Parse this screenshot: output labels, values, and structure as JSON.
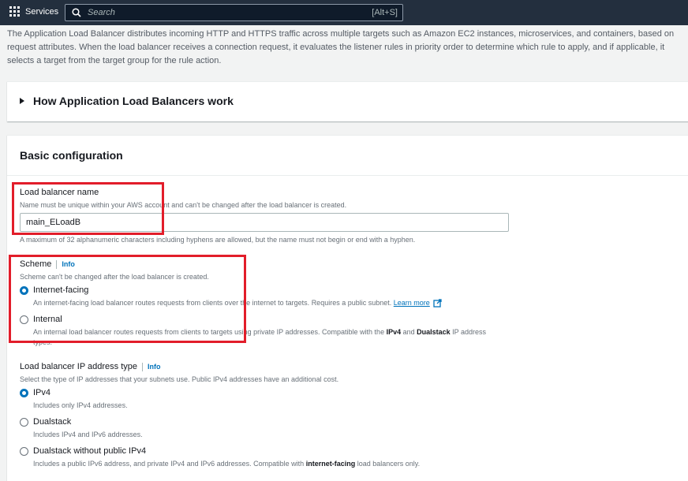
{
  "topbar": {
    "services_label": "Services",
    "search_placeholder": "Search",
    "search_shortcut": "[Alt+S]"
  },
  "intro_text": "The Application Load Balancer distributes incoming HTTP and HTTPS traffic across multiple targets such as Amazon EC2 instances, microservices, and containers, based on request attributes. When the load balancer receives a connection request, it evaluates the listener rules in priority order to determine which rule to apply, and if applicable, it selects a target from the target group for the rule action.",
  "how_section": {
    "title": "How Application Load Balancers work"
  },
  "basic_config": {
    "title": "Basic configuration",
    "name_field": {
      "label": "Load balancer name",
      "description": "Name must be unique within your AWS account and can't be changed after the load balancer is created.",
      "value": "main_ELoadB",
      "constraint": "A maximum of 32 alphanumeric characters including hyphens are allowed, but the name must not begin or end with a hyphen."
    },
    "scheme": {
      "label": "Scheme",
      "info": "Info",
      "description": "Scheme can't be changed after the load balancer is created.",
      "selected": "Internet-facing",
      "options": [
        {
          "label": "Internet-facing",
          "description": "An internet-facing load balancer routes requests from clients over the internet to targets. Requires a public subnet.",
          "link": "Learn more"
        },
        {
          "label": "Internal",
          "description_pre": "An internal load balancer routes requests from clients to targets using private IP addresses. Compatible with the ",
          "bold1": "IPv4",
          "mid": " and ",
          "bold2": "Dualstack",
          "post": " IP address types."
        }
      ]
    },
    "ip_type": {
      "label": "Load balancer IP address type",
      "info": "Info",
      "description": "Select the type of IP addresses that your subnets use. Public IPv4 addresses have an additional cost.",
      "selected": "IPv4",
      "options": [
        {
          "label": "IPv4",
          "description": "Includes only IPv4 addresses."
        },
        {
          "label": "Dualstack",
          "description": "Includes IPv4 and IPv6 addresses."
        },
        {
          "label": "Dualstack without public IPv4",
          "description_pre": "Includes a public IPv6 address, and private IPv4 and IPv6 addresses. Compatible with ",
          "bold": "internet-facing",
          "post": " load balancers only."
        }
      ]
    }
  },
  "colors": {
    "topbar": "#232f3e",
    "accent": "#0073bb",
    "highlight_box": "#e21d2a"
  }
}
